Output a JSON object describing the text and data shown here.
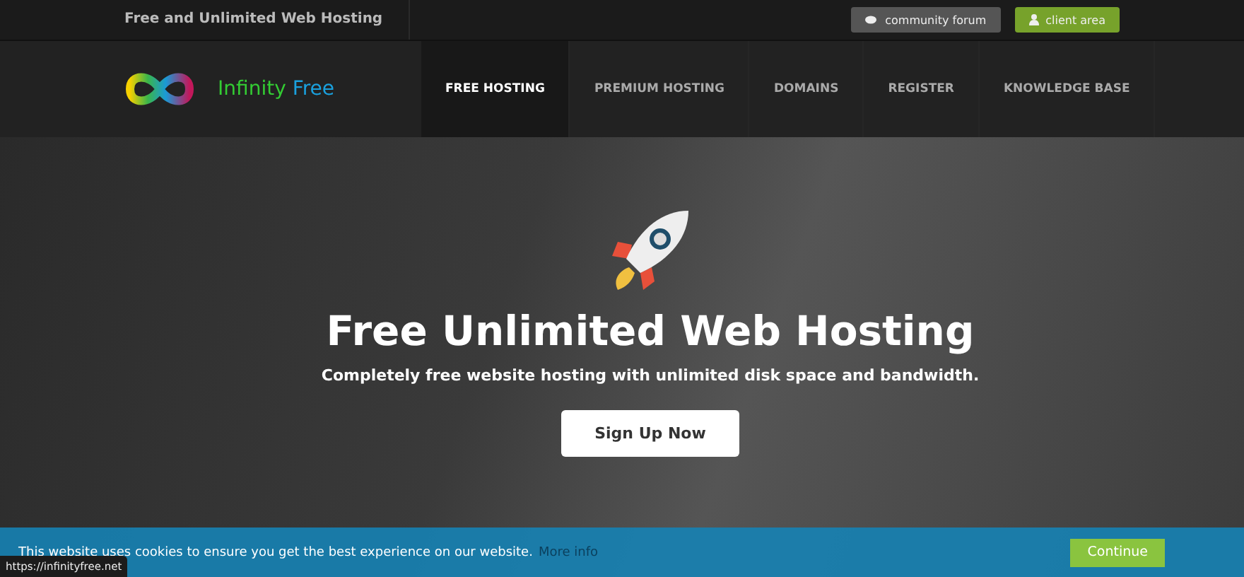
{
  "top_bar": {
    "tagline": "Free and Unlimited Web Hosting",
    "buttons": [
      {
        "kind": "forum",
        "label": "community forum"
      },
      {
        "kind": "client",
        "label": "client area"
      }
    ]
  },
  "logo": {
    "first": "Infinity",
    "second": "Free"
  },
  "nav": [
    {
      "label": "FREE HOSTING",
      "selected": true
    },
    {
      "label": "PREMIUM HOSTING",
      "selected": false
    },
    {
      "label": "DOMAINS",
      "selected": false
    },
    {
      "label": "REGISTER",
      "selected": false
    },
    {
      "label": "KNOWLEDGE BASE",
      "selected": false
    }
  ],
  "hero": {
    "title": "Free Unlimited Web Hosting",
    "subtitle": "Completely free website hosting with unlimited disk space and bandwidth.",
    "button": "Sign Up Now"
  },
  "cookie_bar": {
    "message": "This website uses cookies to ensure you get the best experience on our website.",
    "link": "More info",
    "button": "Continue"
  },
  "status_url": "https://infinityfree.net"
}
